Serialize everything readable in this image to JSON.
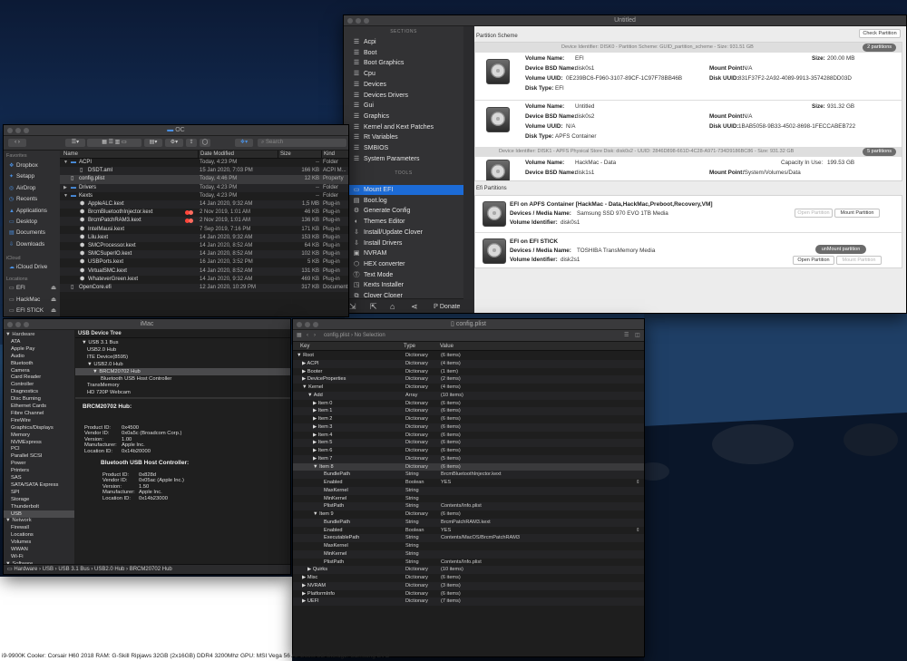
{
  "hackintool": {
    "title": "Untitled",
    "sections_header": "SECTIONS",
    "tools_header": "TOOLS",
    "sections": [
      {
        "label": "Acpi",
        "icon": "list-icon"
      },
      {
        "label": "Boot",
        "icon": "list-icon"
      },
      {
        "label": "Boot Graphics",
        "icon": "list-icon"
      },
      {
        "label": "Cpu",
        "icon": "list-icon"
      },
      {
        "label": "Devices",
        "icon": "list-icon"
      },
      {
        "label": "Devices Drivers",
        "icon": "list-icon"
      },
      {
        "label": "Gui",
        "icon": "list-icon"
      },
      {
        "label": "Graphics",
        "icon": "list-icon"
      },
      {
        "label": "Kernel and Kext Patches",
        "icon": "list-icon"
      },
      {
        "label": "Rt Variables",
        "icon": "list-icon"
      },
      {
        "label": "SMBIOS",
        "icon": "list-icon"
      },
      {
        "label": "System Parameters",
        "icon": "list-icon"
      }
    ],
    "tools": [
      {
        "label": "Mount EFI",
        "icon": "disk-icon",
        "selected": true
      },
      {
        "label": "Boot.log",
        "icon": "document-icon"
      },
      {
        "label": "Generate Config",
        "icon": "gear-icon"
      },
      {
        "label": "Themes Editor",
        "icon": "palette-icon"
      },
      {
        "label": "Install/Update Clover",
        "icon": "download-icon"
      },
      {
        "label": "Install Drivers",
        "icon": "download-icon"
      },
      {
        "label": "NVRAM",
        "icon": "chip-icon"
      },
      {
        "label": "HEX converter",
        "icon": "hex-icon"
      },
      {
        "label": "Text Mode",
        "icon": "text-icon"
      },
      {
        "label": "Kexts Installer",
        "icon": "kext-icon"
      },
      {
        "label": "Clover Cloner",
        "icon": "clone-icon"
      }
    ],
    "donate_label": "Donate",
    "check_partition": "Check Partition",
    "partition_scheme_title": "Partition Scheme",
    "disk0_header": "Device Identifier: DISK0 - Partition Scheme: GUID_partition_scheme - Size: 931.51 GB",
    "disk0_badge": "2 partitions",
    "disk1_header": "Device Identifier: DISK1 - APFS Physical Store Disk: disk0s2 - UUID: 2846D898-661D-4C28-A971-734D9186BC86 - Size: 931.32 GB",
    "disk1_badge": "5 partitions",
    "partitions": [
      {
        "name_label": "Volume Name:",
        "name": "EFI",
        "bsd_label": "Device BSD Name:",
        "bsd": "disk0s1",
        "uuid_label": "Volume UUID:",
        "uuid": "0E239BC6-F960-3107-89CF-1C97F78BB46B",
        "type_label": "Disk Type:",
        "type": "EFI",
        "size_label": "Size:",
        "size": "200.00 MB",
        "mount_label": "Mount Point:",
        "mount": "N/A",
        "duuid_label": "Disk UUID:",
        "duuid": "831F37F2-2A92-4089-9913-3574288DD03D"
      },
      {
        "name_label": "Volume Name:",
        "name": "Untitled",
        "bsd_label": "Device BSD Name:",
        "bsd": "disk0s2",
        "uuid_label": "Volume UUID:",
        "uuid": "N/A",
        "type_label": "Disk Type:",
        "type": "APFS Container",
        "size_label": "Size:",
        "size": "931.32 GB",
        "mount_label": "Mount Point:",
        "mount": "N/A",
        "duuid_label": "Disk UUID:",
        "duuid": "1BAB5058-9B33-4502-8698-1FECCABEB722"
      },
      {
        "name_label": "Volume Name:",
        "name": "HackMac - Data",
        "bsd_label": "Device BSD Name:",
        "bsd": "disk1s1",
        "size_label": "Capacity In Use:",
        "size": "199.53 GB",
        "mount_label": "Mount Point:",
        "mount": "/System/Volumes/Data"
      }
    ],
    "efi_partitions_title": "Efi Partitions",
    "efi": [
      {
        "title": "EFI on APFS Container [HackMac - Data,HackMac,Preboot,Recovery,VM]",
        "media_label": "Devices / Media Name:",
        "media": "Samsung SSD 970 EVO 1TB Media",
        "vid_label": "Volume Identifier:",
        "vid": "disk0s1",
        "btn1": "Open Partition",
        "btn2": "Mount Partition"
      },
      {
        "title": "EFI on EFI STICK",
        "media_label": "Devices / Media Name:",
        "media": "TOSHIBA TransMemory Media",
        "vid_label": "Volume Identifier:",
        "vid": "disk2s1",
        "badge": "unMount partition",
        "btn1": "Open Partition",
        "btn2": "Mount Partition"
      }
    ]
  },
  "finder": {
    "title": "OC",
    "search_placeholder": "Search",
    "columns": {
      "name": "Name",
      "date": "Date Modified",
      "size": "Size",
      "kind": "Kind"
    },
    "favorites_header": "Favorites",
    "favorites": [
      "Dropbox",
      "Setapp",
      "AirDrop",
      "Recents",
      "Applications",
      "Desktop",
      "Documents",
      "Downloads"
    ],
    "icloud_header": "iCloud",
    "icloud": [
      "iCloud Drive"
    ],
    "locations_header": "Locations",
    "locations": [
      "EFI",
      "HackMac",
      "EFI STICK"
    ],
    "rows": [
      {
        "name": "ACPI",
        "date": "Today, 4:23 PM",
        "size": "--",
        "kind": "Folder",
        "indent": 0,
        "disclosure": "▼",
        "folder": true
      },
      {
        "name": "DSDT.aml",
        "date": "15 Jan 2020, 7:03 PM",
        "size": "166 KB",
        "kind": "ACPI M...",
        "indent": 1
      },
      {
        "name": "config.plist",
        "date": "Today, 4:46 PM",
        "size": "12 KB",
        "kind": "Property",
        "indent": 0
      },
      {
        "name": "Drivers",
        "date": "Today, 4:23 PM",
        "size": "--",
        "kind": "Folder",
        "indent": 0,
        "disclosure": "▶",
        "folder": true
      },
      {
        "name": "Kexts",
        "date": "Today, 4:23 PM",
        "size": "--",
        "kind": "Folder",
        "indent": 0,
        "disclosure": "▼",
        "folder": true
      },
      {
        "name": "AppleALC.kext",
        "date": "14 Jan 2020, 9:32 AM",
        "size": "1,5 MB",
        "kind": "Plug-in",
        "indent": 1
      },
      {
        "name": "BrcmBluetoothInjector.kext",
        "date": "2 Nov 2019, 1:01 AM",
        "size": "46 KB",
        "kind": "Plug-in",
        "indent": 1,
        "tag": true
      },
      {
        "name": "BrcmPatchRAM3.kext",
        "date": "2 Nov 2019, 1:01 AM",
        "size": "136 KB",
        "kind": "Plug-in",
        "indent": 1,
        "tag": true
      },
      {
        "name": "IntelMausi.kext",
        "date": "7 Sep 2019, 7:16 PM",
        "size": "171 KB",
        "kind": "Plug-in",
        "indent": 1
      },
      {
        "name": "Lilu.kext",
        "date": "14 Jan 2020, 9:32 AM",
        "size": "153 KB",
        "kind": "Plug-in",
        "indent": 1
      },
      {
        "name": "SMCProcessor.kext",
        "date": "14 Jan 2020, 8:52 AM",
        "size": "64 KB",
        "kind": "Plug-in",
        "indent": 1
      },
      {
        "name": "SMCSuperIO.kext",
        "date": "14 Jan 2020, 8:52 AM",
        "size": "102 KB",
        "kind": "Plug-in",
        "indent": 1
      },
      {
        "name": "USBPorts.kext",
        "date": "16 Jan 2020, 3:52 PM",
        "size": "5 KB",
        "kind": "Plug-in",
        "indent": 1
      },
      {
        "name": "VirtualSMC.kext",
        "date": "14 Jan 2020, 8:52 AM",
        "size": "131 KB",
        "kind": "Plug-in",
        "indent": 1
      },
      {
        "name": "WhateverGreen.kext",
        "date": "14 Jan 2020, 9:32 AM",
        "size": "469 KB",
        "kind": "Plug-in",
        "indent": 1
      },
      {
        "name": "OpenCore.efi",
        "date": "12 Jan 2020, 10:29 PM",
        "size": "317 KB",
        "kind": "Document",
        "indent": 0
      }
    ]
  },
  "imac": {
    "title": "iMac",
    "tree": [
      {
        "t": "▼ Hardware",
        "l": 0
      },
      {
        "t": "ATA",
        "l": 2
      },
      {
        "t": "Apple Pay",
        "l": 2
      },
      {
        "t": "Audio",
        "l": 2
      },
      {
        "t": "Bluetooth",
        "l": 2
      },
      {
        "t": "Camera",
        "l": 2
      },
      {
        "t": "Card Reader",
        "l": 2
      },
      {
        "t": "Controller",
        "l": 2
      },
      {
        "t": "Diagnostics",
        "l": 2
      },
      {
        "t": "Disc Burning",
        "l": 2
      },
      {
        "t": "Ethernet Cards",
        "l": 2
      },
      {
        "t": "Fibre Channel",
        "l": 2
      },
      {
        "t": "FireWire",
        "l": 2
      },
      {
        "t": "Graphics/Displays",
        "l": 2
      },
      {
        "t": "Memory",
        "l": 2
      },
      {
        "t": "NVMExpress",
        "l": 2
      },
      {
        "t": "PCI",
        "l": 2
      },
      {
        "t": "Parallel SCSI",
        "l": 2
      },
      {
        "t": "Power",
        "l": 2
      },
      {
        "t": "Printers",
        "l": 2
      },
      {
        "t": "SAS",
        "l": 2
      },
      {
        "t": "SATA/SATA Express",
        "l": 2
      },
      {
        "t": "SPI",
        "l": 2
      },
      {
        "t": "Storage",
        "l": 2
      },
      {
        "t": "Thunderbolt",
        "l": 2
      },
      {
        "t": "USB",
        "l": 2,
        "sel": true
      },
      {
        "t": "▼ Network",
        "l": 0
      },
      {
        "t": "Firewall",
        "l": 2
      },
      {
        "t": "Locations",
        "l": 2
      },
      {
        "t": "Volumes",
        "l": 2
      },
      {
        "t": "WWAN",
        "l": 2
      },
      {
        "t": "Wi-Fi",
        "l": 2
      },
      {
        "t": "▼ Software",
        "l": 0
      },
      {
        "t": "Accessibility",
        "l": 2
      }
    ],
    "usb_tree_header": "USB Device Tree",
    "usb_tree": [
      {
        "t": "▼ USB 3.1 Bus",
        "l": 1
      },
      {
        "t": "USB2.0 Hub",
        "l": 3
      },
      {
        "t": "ITE Device(8595)",
        "l": 3
      },
      {
        "t": "▼ USB2.0 Hub",
        "l": 3
      },
      {
        "t": "▼ BRCM20702 Hub",
        "l": 5,
        "sel": true
      },
      {
        "t": "Bluetooth USB Host Controller",
        "l": 8
      },
      {
        "t": "TransMemory",
        "l": 3
      },
      {
        "t": "HD 720P Webcam",
        "l": 3
      }
    ],
    "hub_title": "BRCM20702 Hub:",
    "hub_props": [
      {
        "k": "Product ID:",
        "v": "0x4500"
      },
      {
        "k": "Vendor ID:",
        "v": "0x0a5c  (Broadcom Corp.)"
      },
      {
        "k": "Version:",
        "v": "1.00"
      },
      {
        "k": "Manufacturer:",
        "v": "Apple Inc."
      },
      {
        "k": "Location ID:",
        "v": "0x14b20000"
      }
    ],
    "ctrl_title": "Bluetooth USB Host Controller:",
    "ctrl_props": [
      {
        "k": "Product ID:",
        "v": "0x828d"
      },
      {
        "k": "Vendor ID:",
        "v": "0x05ac  (Apple Inc.)"
      },
      {
        "k": "Version:",
        "v": "1.50"
      },
      {
        "k": "Manufacturer:",
        "v": "Apple Inc."
      },
      {
        "k": "Location ID:",
        "v": "0x14b23000"
      }
    ],
    "path": "▭ Hardware › USB › USB 3.1 Bus › USB2.0 Hub › BRCM20702 Hub"
  },
  "plist": {
    "title": "config.plist",
    "breadcrumb": "config.plist › No Selection",
    "columns": {
      "key": "Key",
      "type": "Type",
      "value": "Value"
    },
    "rows": [
      {
        "k": "▼ Root",
        "l": 0,
        "t": "Dictionary",
        "v": "(6 items)"
      },
      {
        "k": "▶ ACPI",
        "l": 1,
        "t": "Dictionary",
        "v": "(4 items)"
      },
      {
        "k": "▶ Booter",
        "l": 1,
        "t": "Dictionary",
        "v": "(1 item)"
      },
      {
        "k": "▶ DeviceProperties",
        "l": 1,
        "t": "Dictionary",
        "v": "(2 items)"
      },
      {
        "k": "▼ Kernel",
        "l": 1,
        "t": "Dictionary",
        "v": "(4 items)"
      },
      {
        "k": "▼ Add",
        "l": 2,
        "t": "Array",
        "v": "(10 items)"
      },
      {
        "k": "▶ Item 0",
        "l": 3,
        "t": "Dictionary",
        "v": "(6 items)"
      },
      {
        "k": "▶ Item 1",
        "l": 3,
        "t": "Dictionary",
        "v": "(6 items)"
      },
      {
        "k": "▶ Item 2",
        "l": 3,
        "t": "Dictionary",
        "v": "(6 items)"
      },
      {
        "k": "▶ Item 3",
        "l": 3,
        "t": "Dictionary",
        "v": "(6 items)"
      },
      {
        "k": "▶ Item 4",
        "l": 3,
        "t": "Dictionary",
        "v": "(6 items)"
      },
      {
        "k": "▶ Item 5",
        "l": 3,
        "t": "Dictionary",
        "v": "(6 items)"
      },
      {
        "k": "▶ Item 6",
        "l": 3,
        "t": "Dictionary",
        "v": "(6 items)"
      },
      {
        "k": "▶ Item 7",
        "l": 3,
        "t": "Dictionary",
        "v": "(5 items)"
      },
      {
        "k": "▼ Item 8",
        "l": 3,
        "t": "Dictionary",
        "v": "(6 items)"
      },
      {
        "k": "BundlePath",
        "l": 5,
        "t": "String",
        "v": "BrcmBluetoothInjector.kext"
      },
      {
        "k": "Enabled",
        "l": 5,
        "t": "Boolean",
        "v": "YES",
        "stepper": true
      },
      {
        "k": "MaxKernel",
        "l": 5,
        "t": "String",
        "v": ""
      },
      {
        "k": "MinKernel",
        "l": 5,
        "t": "String",
        "v": ""
      },
      {
        "k": "PlistPath",
        "l": 5,
        "t": "String",
        "v": "Contents/Info.plist"
      },
      {
        "k": "▼ Item 9",
        "l": 3,
        "t": "Dictionary",
        "v": "(6 items)"
      },
      {
        "k": "BundlePath",
        "l": 5,
        "t": "String",
        "v": "BrcmPatchRAM3.kext"
      },
      {
        "k": "Enabled",
        "l": 5,
        "t": "Boolean",
        "v": "YES",
        "stepper": true
      },
      {
        "k": "ExecutablePath",
        "l": 5,
        "t": "String",
        "v": "Contents/MacOS/BrcmPatchRAM3"
      },
      {
        "k": "MaxKernel",
        "l": 5,
        "t": "String",
        "v": ""
      },
      {
        "k": "MinKernel",
        "l": 5,
        "t": "String",
        "v": ""
      },
      {
        "k": "PlistPath",
        "l": 5,
        "t": "String",
        "v": "Contents/Info.plist"
      },
      {
        "k": "▶ Quirks",
        "l": 2,
        "t": "Dictionary",
        "v": "(10 items)"
      },
      {
        "k": "▶ Misc",
        "l": 1,
        "t": "Dictionary",
        "v": "(6 items)"
      },
      {
        "k": "▶ NVRAM",
        "l": 1,
        "t": "Dictionary",
        "v": "(3 items)"
      },
      {
        "k": "▶ PlatformInfo",
        "l": 1,
        "t": "Dictionary",
        "v": "(6 items)"
      },
      {
        "k": "▶ UEFI",
        "l": 1,
        "t": "Dictionary",
        "v": "(7 items)"
      }
    ]
  },
  "footer": {
    "text": "i9-9900K  Cooler: Corsair H60 2018  RAM: G-Skill Ripjaws 32GB (2x16GB) DDR4 3200Mhz  GPU: MSI Vega 56 Air Boost 8G  Storage: Samsung EVO"
  }
}
